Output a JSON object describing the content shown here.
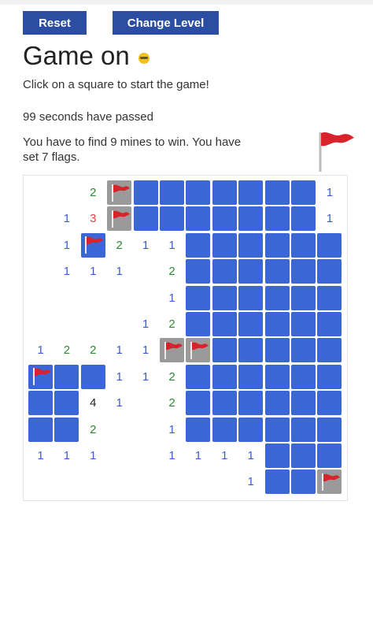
{
  "toolbar": {
    "reset_label": "Reset",
    "change_level_label": "Change Level"
  },
  "status": {
    "title": "Game on",
    "start_message": "Click on a square to start the game!",
    "time_message": "99 seconds have passed",
    "mines_message": "You have to find 9 mines to win. You have set 7 flags."
  },
  "board": {
    "rows": [
      [
        "",
        "",
        "2",
        "F",
        "H",
        "H",
        "H",
        "H",
        "H",
        "H",
        "H",
        "1"
      ],
      [
        "",
        "1",
        "3",
        "F",
        "H",
        "H",
        "H",
        "H",
        "H",
        "H",
        "H",
        "1"
      ],
      [
        "",
        "1",
        "FT",
        "2",
        "1",
        "1",
        "H",
        "H",
        "H",
        "H",
        "H",
        "H"
      ],
      [
        "",
        "1",
        "1",
        "1",
        "",
        "2",
        "H",
        "H",
        "H",
        "H",
        "H",
        "H"
      ],
      [
        "",
        "",
        "",
        "",
        "",
        "1",
        "H",
        "H",
        "H",
        "H",
        "H",
        "H"
      ],
      [
        "",
        "",
        "",
        "",
        "1",
        "2",
        "H",
        "H",
        "H",
        "H",
        "H",
        "H"
      ],
      [
        "1",
        "2",
        "2",
        "1",
        "1",
        "F",
        "F",
        "H",
        "H",
        "H",
        "H",
        "H"
      ],
      [
        "FT",
        "H",
        "H",
        "1",
        "1",
        "2",
        "H",
        "H",
        "H",
        "H",
        "H",
        "H"
      ],
      [
        "H",
        "H",
        "4",
        "1",
        "",
        "2",
        "H",
        "H",
        "H",
        "H",
        "H",
        "H"
      ],
      [
        "H",
        "H",
        "2",
        "",
        "",
        "1",
        "H",
        "H",
        "H",
        "H",
        "H",
        "H"
      ],
      [
        "1",
        "1",
        "1",
        "",
        "",
        "1",
        "1",
        "1",
        "1",
        "H",
        "H",
        "H"
      ],
      [
        "",
        "",
        "",
        "",
        "",
        "",
        "",
        "",
        "1",
        "H",
        "H",
        "F"
      ]
    ],
    "number_colors": {
      "1": "#3b5bd6",
      "2": "#2f8a2f",
      "3": "#e24040",
      "4": "#222222"
    },
    "hidden_color": "#3a66d6",
    "flag_color": "#d8232a"
  }
}
